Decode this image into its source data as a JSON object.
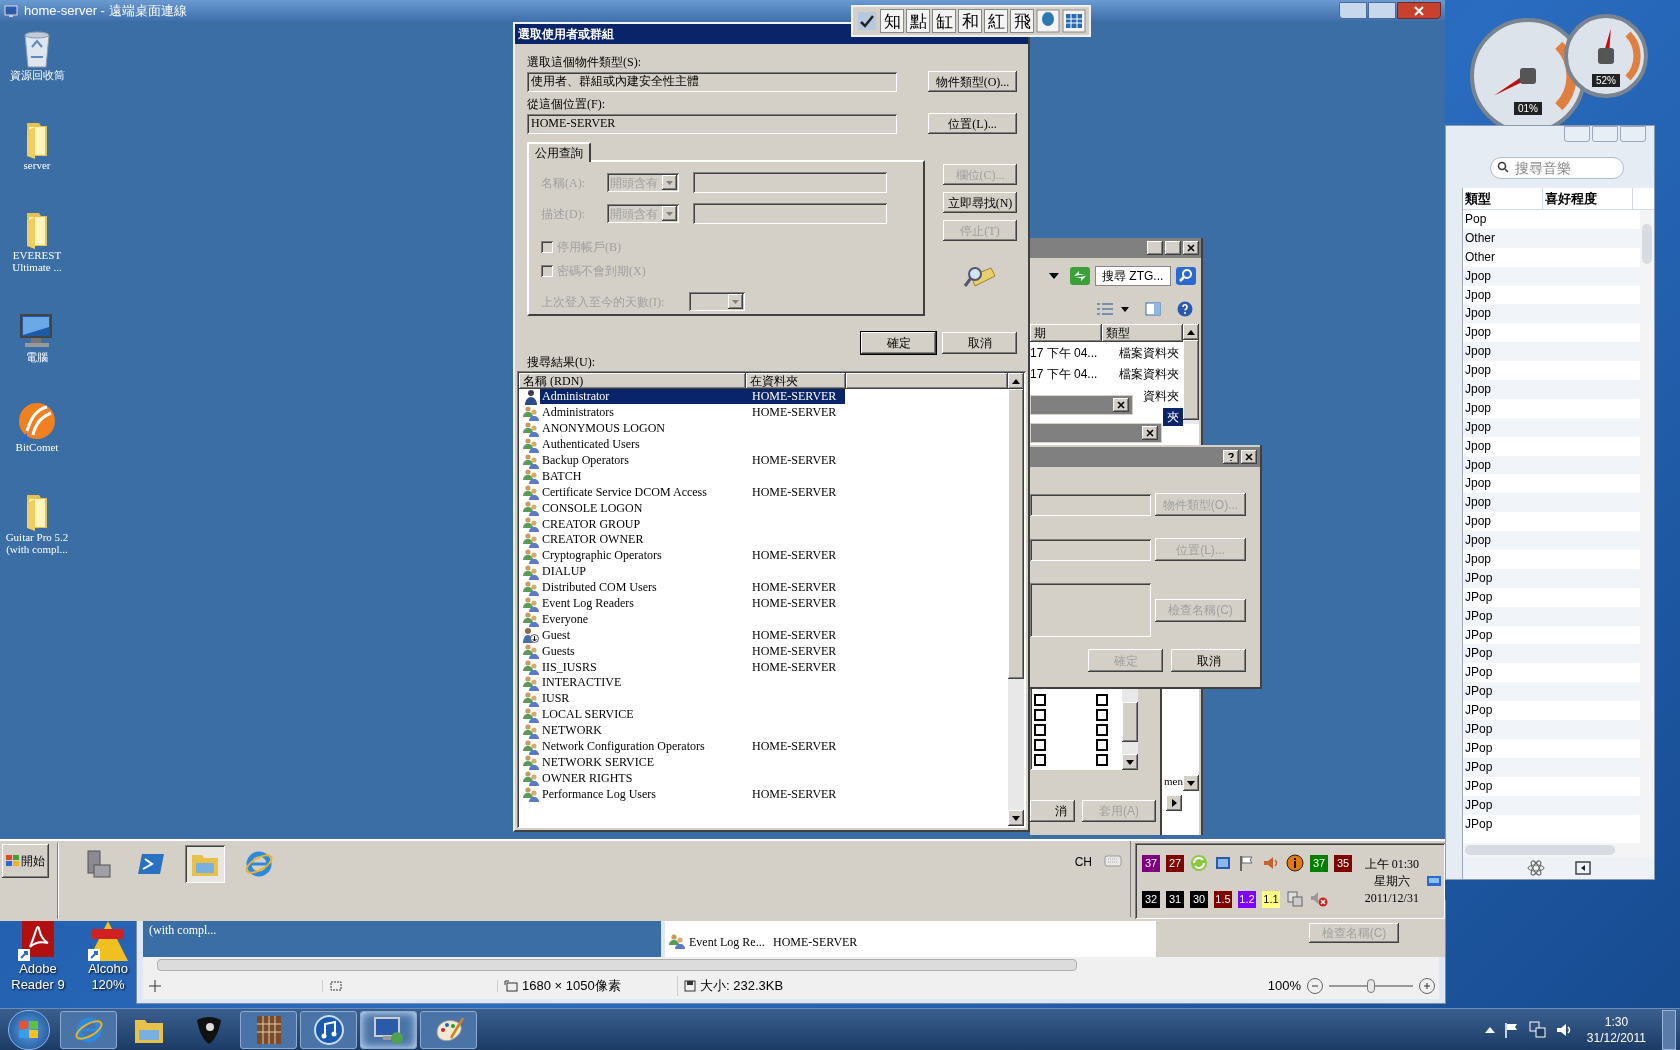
{
  "remote_window": {
    "title": "home-server - 遠端桌面連線"
  },
  "remote_desktop_icons": [
    {
      "label": "資源回收筒",
      "kind": "recycle-bin"
    },
    {
      "label": "server",
      "kind": "folder"
    },
    {
      "label": "EVEREST Ultimate ...",
      "kind": "folder"
    },
    {
      "label": "電腦",
      "kind": "computer"
    },
    {
      "label": "BitComet",
      "kind": "bitcomet"
    },
    {
      "label": "Guitar Pro 5.2 (with compl...",
      "kind": "folder"
    }
  ],
  "ime_toolbar": {
    "keys": [
      "知",
      "點",
      "缸",
      "和",
      "紅",
      "飛"
    ]
  },
  "select_dialog": {
    "title": "選取使用者或群組",
    "object_type": {
      "label": "選取這個物件類型(S):",
      "value": "使用者、群組或內建安全性主體",
      "button": "物件類型(O)..."
    },
    "location": {
      "label": "從這個位置(F):",
      "value": "HOME-SERVER",
      "button": "位置(L)..."
    },
    "tabs": [
      {
        "label": "公用查詢",
        "selected": true
      }
    ],
    "query": {
      "disabled": true,
      "name_label": "名稱(A):",
      "name_mode": "開頭含有",
      "desc_label": "描述(D):",
      "desc_mode": "開頭含有",
      "checkboxes": [
        {
          "label": "停用帳戶(B)",
          "checked": false
        },
        {
          "label": "密碼不會到期(X)",
          "checked": false
        }
      ],
      "days_label": "上次登入至今的天數(I):"
    },
    "side_buttons": [
      {
        "label": "欄位(C)...",
        "disabled": true
      },
      {
        "label": "立即尋找(N)",
        "disabled": false
      },
      {
        "label": "停止(T)",
        "disabled": true
      }
    ],
    "ok": "確定",
    "cancel": "取消",
    "results": {
      "label": "搜尋結果(U):",
      "columns": [
        "名稱 (RDN)",
        "在資料夾"
      ],
      "rows": [
        {
          "name": "Administrator",
          "folder": "HOME-SERVER",
          "kind": "user",
          "selected": true
        },
        {
          "name": "Administrators",
          "folder": "HOME-SERVER",
          "kind": "group",
          "selected": false
        },
        {
          "name": "ANONYMOUS LOGON",
          "kind": "group",
          "selected": false
        },
        {
          "name": "Authenticated Users",
          "kind": "group",
          "selected": false
        },
        {
          "name": "Backup Operators",
          "folder": "HOME-SERVER",
          "kind": "group",
          "selected": false
        },
        {
          "name": "BATCH",
          "kind": "group",
          "selected": false
        },
        {
          "name": "Certificate Service DCOM Access",
          "folder": "HOME-SERVER",
          "kind": "group",
          "selected": false
        },
        {
          "name": "CONSOLE LOGON",
          "kind": "group",
          "selected": false
        },
        {
          "name": "CREATOR GROUP",
          "kind": "group",
          "selected": false
        },
        {
          "name": "CREATOR OWNER",
          "kind": "group",
          "selected": false
        },
        {
          "name": "Cryptographic Operators",
          "folder": "HOME-SERVER",
          "kind": "group",
          "selected": false
        },
        {
          "name": "DIALUP",
          "kind": "group",
          "selected": false
        },
        {
          "name": "Distributed COM Users",
          "folder": "HOME-SERVER",
          "kind": "group",
          "selected": false
        },
        {
          "name": "Event Log Readers",
          "folder": "HOME-SERVER",
          "kind": "group",
          "selected": false
        },
        {
          "name": "Everyone",
          "kind": "group",
          "selected": false
        },
        {
          "name": "Guest",
          "folder": "HOME-SERVER",
          "kind": "guest",
          "selected": false
        },
        {
          "name": "Guests",
          "folder": "HOME-SERVER",
          "kind": "group",
          "selected": false
        },
        {
          "name": "IIS_IUSRS",
          "folder": "HOME-SERVER",
          "kind": "group",
          "selected": false
        },
        {
          "name": "INTERACTIVE",
          "kind": "group",
          "selected": false
        },
        {
          "name": "IUSR",
          "kind": "group",
          "selected": false
        },
        {
          "name": "LOCAL SERVICE",
          "kind": "group",
          "selected": false
        },
        {
          "name": "NETWORK",
          "kind": "group",
          "selected": false
        },
        {
          "name": "Network Configuration Operators",
          "folder": "HOME-SERVER",
          "kind": "group",
          "selected": false
        },
        {
          "name": "NETWORK SERVICE",
          "kind": "group",
          "selected": false
        },
        {
          "name": "OWNER RIGHTS",
          "kind": "group",
          "selected": false
        },
        {
          "name": "Performance Log Users",
          "folder": "HOME-SERVER",
          "kind": "group",
          "selected": false
        }
      ]
    }
  },
  "explorer_window": {
    "search": {
      "value": "搜尋 ZTG..."
    },
    "columns": [
      "期",
      "類型"
    ],
    "rows": [
      {
        "date": "17 下午 04...",
        "type": "檔案資料夾",
        "selected": false
      },
      {
        "date": "17 下午 04...",
        "type": "檔案資料夾",
        "selected": false
      },
      {
        "type": "資料夾",
        "selected": false
      },
      {
        "type": "夾",
        "selected": true
      }
    ],
    "detail_text": "men"
  },
  "object_dialog": {
    "buttons": [
      {
        "label": "物件類型(O)...",
        "disabled": true
      },
      {
        "label": "位置(L)...",
        "disabled": true
      },
      {
        "label": "檢查名稱(C)",
        "disabled": true
      }
    ],
    "ok": {
      "label": "確定",
      "disabled": true
    },
    "cancel": {
      "label": "取消",
      "disabled": false
    }
  },
  "property_sheet": {
    "permissions": [
      {
        "allow": false,
        "deny": false
      },
      {
        "allow": false,
        "deny": false
      },
      {
        "allow": false,
        "deny": false
      },
      {
        "allow": false,
        "deny": false
      },
      {
        "allow": false,
        "deny": false
      }
    ],
    "buttons": [
      {
        "label": "消",
        "disabled": false
      },
      {
        "label": "套用(A)",
        "disabled": true
      }
    ]
  },
  "remote_taskbar": {
    "start": "開始",
    "quick_launch": [
      {
        "kind": "server-tools",
        "selected": false
      },
      {
        "kind": "powershell",
        "selected": false
      },
      {
        "kind": "explorer",
        "selected": true
      },
      {
        "kind": "browser",
        "selected": false
      }
    ],
    "language": "CH",
    "tray_rows": [
      [
        {
          "kind": "badge",
          "text": "37",
          "color": "#800080"
        },
        {
          "kind": "badge",
          "text": "27",
          "color": "#800000"
        },
        {
          "kind": "sync"
        },
        {
          "kind": "network-card"
        },
        {
          "kind": "flag"
        },
        {
          "kind": "speaker"
        },
        {
          "kind": "info"
        },
        {
          "kind": "badge",
          "text": "37",
          "color": "#008000"
        },
        {
          "kind": "badge",
          "text": "35",
          "color": "#800000"
        }
      ],
      [
        {
          "kind": "badge",
          "text": "32",
          "color": "#000000"
        },
        {
          "kind": "badge",
          "text": "31",
          "color": "#000000"
        },
        {
          "kind": "badge",
          "text": "30",
          "color": "#000000"
        },
        {
          "kind": "badge",
          "text": "1.5",
          "color": "#800000"
        },
        {
          "kind": "badge",
          "text": "1.2",
          "color": "#8000ff"
        },
        {
          "kind": "badge",
          "text": "1.1",
          "color": "#ffff80"
        },
        {
          "kind": "printer"
        },
        {
          "kind": "muted"
        }
      ]
    ],
    "clock": {
      "time": "上午 01:30",
      "day": "星期六",
      "date": "2011/12/31"
    }
  },
  "image_viewer": {
    "content": {
      "caption": "(with compl...",
      "row_name": "Event Log Re...",
      "row_folder": "HOME-SERVER",
      "button": "檢查名稱(C)"
    },
    "status": {
      "dimensions": "1680 × 1050像素",
      "size": "大小: 232.3KB",
      "zoom": "100%",
      "zoom_slider": {
        "level": 0.5
      }
    }
  },
  "local_desktop_icons": [
    {
      "lines": [
        "Adobe",
        "Reader 9"
      ],
      "kind": "pdf"
    },
    {
      "lines": [
        "Alcoho",
        "120%"
      ],
      "kind": "alcohol"
    }
  ],
  "gadgets": [
    {
      "kind": "cpu",
      "reading": "01%"
    },
    {
      "kind": "memory",
      "reading": "52%"
    }
  ],
  "music_player": {
    "search": {
      "placeholder": "搜尋音樂"
    },
    "columns": [
      "類型",
      "喜好程度"
    ],
    "rows": [
      "Pop",
      "Other",
      "Other",
      "Jpop",
      "Jpop",
      "Jpop",
      "Jpop",
      "Jpop",
      "Jpop",
      "Jpop",
      "Jpop",
      "Jpop",
      "Jpop",
      "Jpop",
      "Jpop",
      "Jpop",
      "Jpop",
      "Jpop",
      "Jpop",
      "JPop",
      "JPop",
      "JPop",
      "JPop",
      "JPop",
      "JPop",
      "JPop",
      "JPop",
      "JPop",
      "JPop",
      "JPop",
      "JPop",
      "JPop",
      "JPop"
    ]
  },
  "taskbar": {
    "items": [
      {
        "kind": "browser",
        "running": true,
        "active": false
      },
      {
        "kind": "folder",
        "running": false,
        "active": false
      },
      {
        "kind": "pick",
        "running": false,
        "active": false
      },
      {
        "kind": "guitar",
        "running": true,
        "active": false
      },
      {
        "kind": "music",
        "running": true,
        "active": false
      },
      {
        "kind": "remote",
        "running": true,
        "active": true
      },
      {
        "kind": "paint",
        "running": true,
        "active": false
      }
    ],
    "clock": {
      "time": "1:30",
      "date": "31/12/2011"
    }
  }
}
